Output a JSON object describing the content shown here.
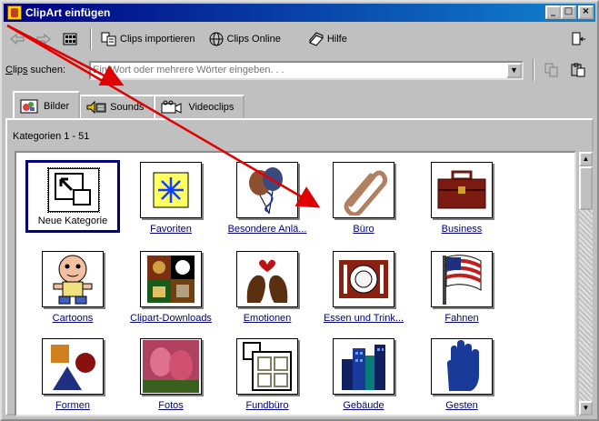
{
  "window": {
    "title": "ClipArt einfügen",
    "controls": {
      "minimize": "_",
      "maximize": "□",
      "close": "×"
    }
  },
  "toolbar": {
    "back_icon": "arrow-left-icon",
    "forward_icon": "arrow-right-icon",
    "view_icon": "grid-view-icon",
    "import_label": "Clips importieren",
    "online_label": "Clips Online",
    "help_label": "Hilfe",
    "copy_icon": "copy-icon",
    "paste_icon": "paste-icon",
    "pane_icon": "pane-icon"
  },
  "search": {
    "label": "Clips suchen:",
    "placeholder": "Ein Wort oder mehrere Wörter eingeben. . .",
    "value": ""
  },
  "tabs": [
    {
      "label": "Bilder",
      "active": true,
      "icon": "picture-icon"
    },
    {
      "label": "Sounds",
      "active": false,
      "icon": "speaker-icon"
    },
    {
      "label": "Videoclips",
      "active": false,
      "icon": "camera-icon"
    }
  ],
  "panel": {
    "category_count": "Kategorien 1 - 51"
  },
  "categories": [
    {
      "label": "Neue Kategorie",
      "icon": "new-category-icon",
      "selected": true
    },
    {
      "label": "Favoriten",
      "icon": "star-icon"
    },
    {
      "label": "Besondere Anlä...",
      "icon": "balloons-icon"
    },
    {
      "label": "Büro",
      "icon": "paperclip-icon"
    },
    {
      "label": "Business",
      "icon": "briefcase-icon"
    },
    {
      "label": "Cartoons",
      "icon": "cartoon-baby-icon"
    },
    {
      "label": "Clipart-Downloads",
      "icon": "photo-collage-icon"
    },
    {
      "label": "Emotionen",
      "icon": "faces-heart-icon"
    },
    {
      "label": "Essen und Trink...",
      "icon": "plate-cutlery-icon"
    },
    {
      "label": "Fahnen",
      "icon": "flag-icon"
    },
    {
      "label": "Formen",
      "icon": "shapes-icon"
    },
    {
      "label": "Fotos",
      "icon": "tulips-photo-icon"
    },
    {
      "label": "Fundbüro",
      "icon": "lost-found-icon"
    },
    {
      "label": "Gebäude",
      "icon": "buildings-icon"
    },
    {
      "label": "Gesten",
      "icon": "hand-icon"
    }
  ],
  "colors": {
    "title_bar_start": "#000080",
    "title_bar_end": "#1084d0",
    "link": "#000080",
    "annotation_arrow": "#e00000"
  }
}
